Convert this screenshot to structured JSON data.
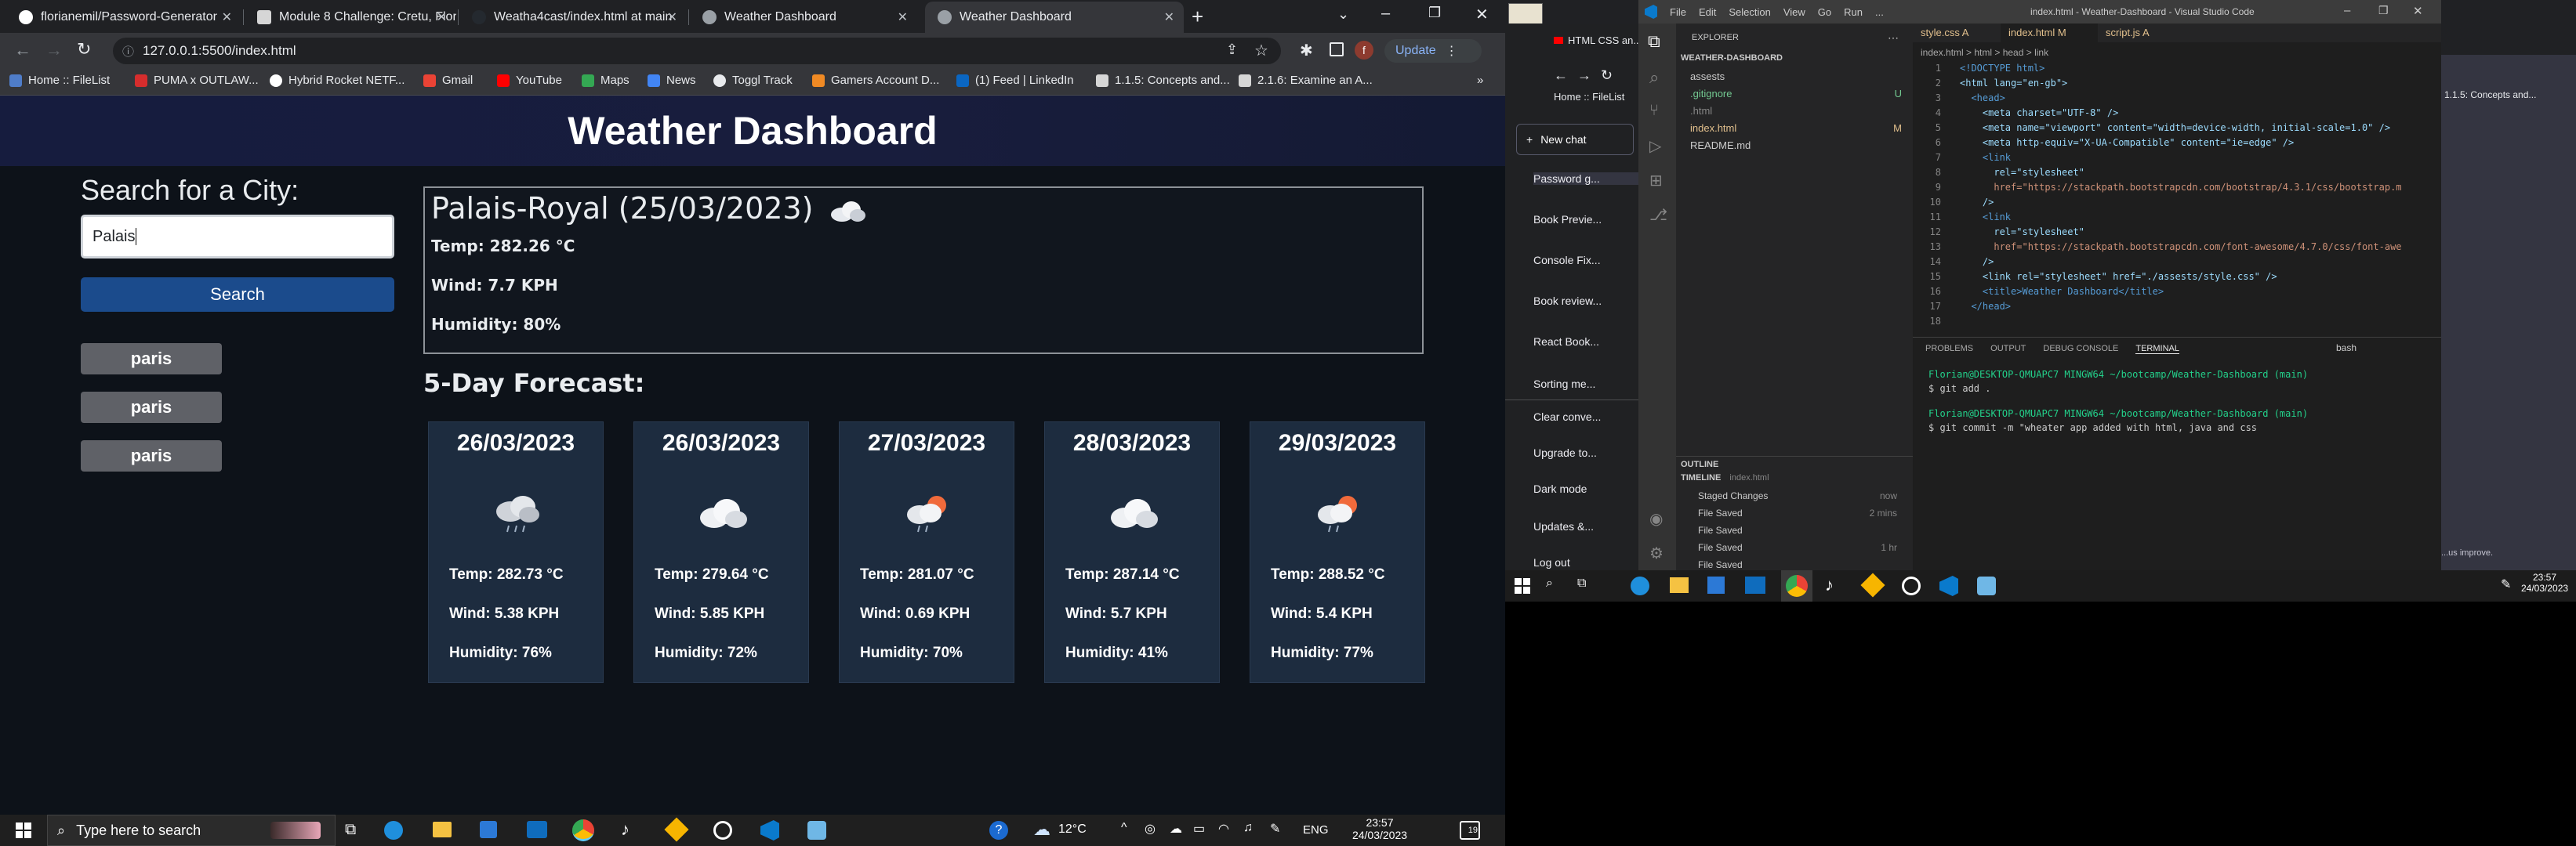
{
  "chrome": {
    "tabs": [
      {
        "label": "florianemil/Password-Generator"
      },
      {
        "label": "Module 8 Challenge: Cretu, Flori"
      },
      {
        "label": "Weatha4cast/index.html at main"
      },
      {
        "label": "Weather Dashboard"
      },
      {
        "label": "Weather Dashboard"
      }
    ],
    "new_tab": "+",
    "url": "127.0.0.1:5500/index.html",
    "update_label": "Update",
    "profile_initial": "f",
    "bookmarks": [
      "Home :: FileList",
      "PUMA x OUTLAW...",
      "Hybrid Rocket NETF...",
      "Gmail",
      "YouTube",
      "Maps",
      "News",
      "Toggl Track",
      "Gamers Account D...",
      "(1) Feed | LinkedIn",
      "1.1.5: Concepts and...",
      "2.1.6: Examine an A..."
    ],
    "more_bookmarks": "»"
  },
  "page": {
    "header": "Weather Dashboard",
    "search_title": "Search for a City:",
    "search_value": "Palais",
    "search_button": "Search",
    "history": [
      "paris",
      "paris",
      "paris"
    ],
    "current": {
      "title": "Palais-Royal (25/03/2023)",
      "temp": "Temp: 282.26 °C",
      "wind": "Wind: 7.7 KPH",
      "humidity": "Humidity: 80%"
    },
    "forecast_title": "5-Day Forecast:",
    "forecast": [
      {
        "date": "26/03/2023",
        "icon": "rain-cloud",
        "temp": "Temp: 282.73 °C",
        "wind": "Wind: 5.38 KPH",
        "humidity": "Humidity: 76%"
      },
      {
        "date": "26/03/2023",
        "icon": "cloud",
        "temp": "Temp: 279.64 °C",
        "wind": "Wind: 5.85 KPH",
        "humidity": "Humidity: 72%"
      },
      {
        "date": "27/03/2023",
        "icon": "sun-rain",
        "temp": "Temp: 281.07 °C",
        "wind": "Wind: 0.69 KPH",
        "humidity": "Humidity: 70%"
      },
      {
        "date": "28/03/2023",
        "icon": "cloud",
        "temp": "Temp: 287.14 °C",
        "wind": "Wind: 5.7 KPH",
        "humidity": "Humidity: 41%"
      },
      {
        "date": "29/03/2023",
        "icon": "sun-rain",
        "temp": "Temp: 288.52 °C",
        "wind": "Wind: 5.4 KPH",
        "humidity": "Humidity: 77%"
      }
    ]
  },
  "taskbar": {
    "search_placeholder": "Type here to search",
    "weather": "12°C",
    "lang": "ENG",
    "time": "23:57",
    "date": "24/03/2023",
    "notifications": "19"
  },
  "vscode": {
    "menu": [
      "File",
      "Edit",
      "Selection",
      "View",
      "Go",
      "Run",
      "..."
    ],
    "title": "index.html - Weather-Dashboard - Visual Studio Code",
    "tabs": [
      "style.css A",
      "index.html M",
      "script.js A"
    ],
    "explorer_title": "EXPLORER",
    "workspace": "WEATHER-DASHBOARD",
    "files": [
      {
        "name": "assests",
        "badge": ""
      },
      {
        "name": ".gitignore",
        "badge": "U"
      },
      {
        "name": ".html",
        "badge": ""
      },
      {
        "name": "index.html",
        "badge": "M"
      },
      {
        "name": "README.md",
        "badge": ""
      }
    ],
    "breadcrumb": "index.html > html > head > link",
    "code": [
      "<!DOCTYPE html>",
      "<html lang=\"en-gb\">",
      "  <head>",
      "    <meta charset=\"UTF-8\" />",
      "    <meta name=\"viewport\" content=\"width=device-width, initial-scale=1.0\" />",
      "    <meta http-equiv=\"X-UA-Compatible\" content=\"ie=edge\" />",
      "    <link",
      "      rel=\"stylesheet\"",
      "      href=\"https://stackpath.bootstrapcdn.com/bootstrap/4.3.1/css/bootstrap.m",
      "    />",
      "    <link",
      "      rel=\"stylesheet\"",
      "      href=\"https://stackpath.bootstrapcdn.com/font-awesome/4.7.0/css/font-awe",
      "    />",
      "    <link rel=\"stylesheet\" href=\"./assests/style.css\" />",
      "    <title>Weather Dashboard</title>",
      "  </head>",
      ""
    ],
    "panel_tabs": [
      "PROBLEMS",
      "OUTPUT",
      "DEBUG CONSOLE",
      "TERMINAL"
    ],
    "terminal_shell": "bash",
    "terminal": [
      "Florian@DESKTOP-QMUAPC7 MINGW64 ~/bootcamp/Weather-Dashboard (main)",
      "$ git add .",
      "",
      "Florian@DESKTOP-QMUAPC7 MINGW64 ~/bootcamp/Weather-Dashboard (main)",
      "$ git commit -m \"wheater app added with html, java and css"
    ],
    "outline": "OUTLINE",
    "timeline": "TIMELINE",
    "timeline_file": "index.html",
    "timeline_items": [
      {
        "label": "Staged Changes",
        "time": "now"
      },
      {
        "label": "File Saved",
        "time": "2 mins"
      },
      {
        "label": "File Saved",
        "time": ""
      },
      {
        "label": "File Saved",
        "time": "1 hr"
      },
      {
        "label": "File Saved",
        "time": ""
      }
    ]
  },
  "chat": {
    "tab": "HTML CSS an...",
    "home": "Home :: FileList",
    "new_chat": "New chat",
    "items": [
      "Password g...",
      "Book Previe...",
      "Console Fix...",
      "Book review...",
      "React Book...",
      "Sorting me..."
    ],
    "clear": "Clear conve...",
    "upgrade": "Upgrade to...",
    "dark": "Dark mode",
    "updates": "Updates &...",
    "logout": "Log out",
    "right_bm": "1.1.5: Concepts and...",
    "help": "...us improve."
  },
  "right_taskbar": {
    "time": "23:57",
    "date": "24/03/2023"
  },
  "colors": {
    "page_bg": "#0d1219",
    "header_bg": "#181d3d",
    "card_bg": "#1d2c3f",
    "search_button": "#1b4b8c",
    "history_button": "#5f6167"
  }
}
